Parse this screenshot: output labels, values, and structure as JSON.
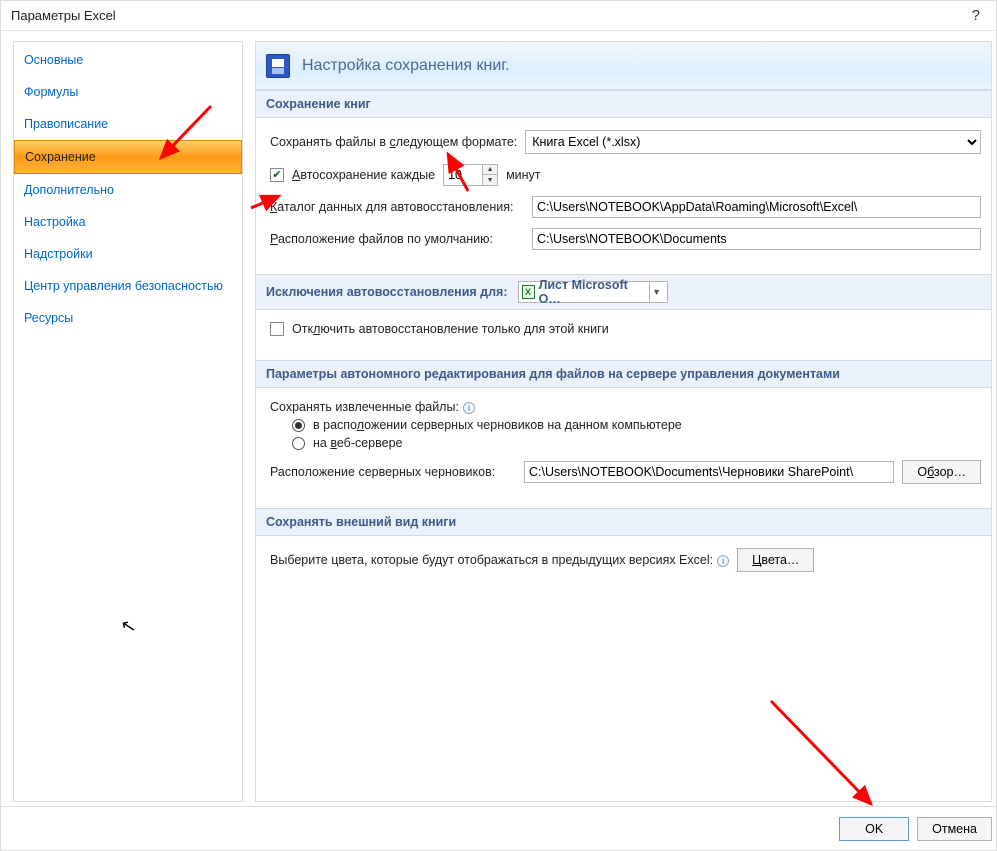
{
  "window": {
    "title": "Параметры Excel",
    "help_glyph": "?"
  },
  "sidebar": {
    "items": [
      {
        "label": "Основные",
        "selected": false
      },
      {
        "label": "Формулы",
        "selected": false
      },
      {
        "label": "Правописание",
        "selected": false
      },
      {
        "label": "Сохранение",
        "selected": true
      },
      {
        "label": "Дополнительно",
        "selected": false
      },
      {
        "label": "Настройка",
        "selected": false
      },
      {
        "label": "Надстройки",
        "selected": false
      },
      {
        "label": "Центр управления безопасностью",
        "selected": false
      },
      {
        "label": "Ресурсы",
        "selected": false
      }
    ]
  },
  "main": {
    "banner_title": "Настройка сохранения книг.",
    "section1": {
      "title": "Сохранение книг",
      "format_label_pre": "Сохранять файлы в ",
      "format_label_key": "с",
      "format_label_post": "ледующем формате:",
      "format_value": "Книга Excel (*.xlsx)",
      "autosave_checked": true,
      "autosave_pre": "",
      "autosave_key": "А",
      "autosave_post": "втосохранение каждые",
      "autosave_value": "10",
      "autosave_unit": "минут",
      "catalog_pre": "",
      "catalog_key": "К",
      "catalog_post": "аталог данных для автовосстановления:",
      "catalog_value": "C:\\Users\\NOTEBOOK\\AppData\\Roaming\\Microsoft\\Excel\\",
      "default_loc_pre": "",
      "default_loc_key": "Р",
      "default_loc_post": "асположение файлов по умолчанию:",
      "default_loc_value": "C:\\Users\\NOTEBOOK\\Documents"
    },
    "section2": {
      "title": "Исключения автовосстановления для:",
      "workbook_name": "Лист Microsoft O…",
      "disable_cb_pre": "Отк",
      "disable_cb_key": "л",
      "disable_cb_post": "ючить автовосстановление только для этой книги",
      "disable_checked": false
    },
    "section3": {
      "title": "Параметры автономного редактирования для файлов на сервере управления документами",
      "keep_extracted": "Сохранять извлеченные файлы:",
      "radio1_pre": "в распо",
      "radio1_key": "л",
      "radio1_post": "ожении серверных черновиков на данном компьютере",
      "radio2_pre": "на ",
      "radio2_key": "в",
      "radio2_post": "еб-сервере",
      "drafts_loc_label": "Расположение серверных черновиков:",
      "drafts_loc_value": "C:\\Users\\NOTEBOOK\\Documents\\Черновики SharePoint\\",
      "browse_pre": "О",
      "browse_key": "б",
      "browse_post": "зор…"
    },
    "section4": {
      "title": "Сохранять внешний вид книги",
      "legacy_colors_text": "Выберите цвета, которые будут отображаться в предыдущих версиях Excel:",
      "colors_btn_key": "Ц",
      "colors_btn_post": "вета…"
    }
  },
  "footer": {
    "ok": "OK",
    "cancel": "Отмена"
  }
}
